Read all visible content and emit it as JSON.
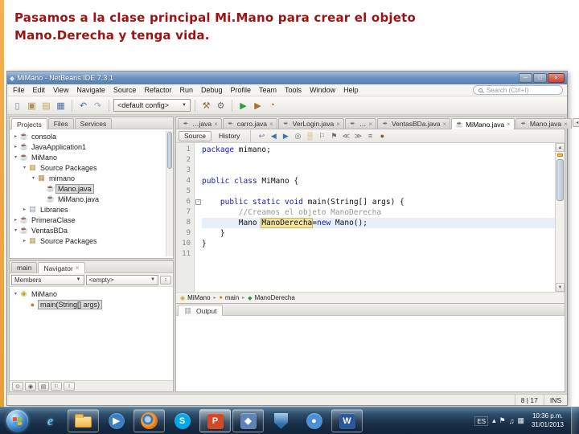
{
  "slide": {
    "title_lines": [
      "Pasamos a la clase principal Mi.Mano para crear el objeto",
      "Mano.Derecha y tenga vida."
    ],
    "accent_color": "#9c1313"
  },
  "window": {
    "title": "MiMano - NetBeans IDE 7.3.1",
    "controls": {
      "minimize": "─",
      "maximize": "□",
      "close": "×"
    },
    "menu": [
      "File",
      "Edit",
      "View",
      "Navigate",
      "Source",
      "Refactor",
      "Run",
      "Debug",
      "Profile",
      "Team",
      "Tools",
      "Window",
      "Help"
    ],
    "search_placeholder": "Search (Ctrl+I)"
  },
  "toolbar": {
    "config_value": "<default config>",
    "file_icons": [
      {
        "name": "new-file-icon",
        "glyph": "▯",
        "color": "#7d8b99"
      },
      {
        "name": "new-project-icon",
        "glyph": "▣",
        "color": "#b08d55"
      },
      {
        "name": "open-project-icon",
        "glyph": "▤",
        "color": "#c9a05a"
      },
      {
        "name": "save-all-icon",
        "glyph": "▦",
        "color": "#4a6fae"
      }
    ],
    "edit_icons": [
      {
        "name": "undo-icon",
        "glyph": "↶",
        "color": "#4a6fae"
      },
      {
        "name": "redo-icon",
        "glyph": "↷",
        "color": "#9aa7b5"
      }
    ],
    "build_icons": [
      {
        "name": "build-project-icon",
        "glyph": "⚒",
        "color": "#8a6d3b"
      },
      {
        "name": "clean-build-icon",
        "glyph": "⚙",
        "color": "#6d6b67"
      }
    ],
    "run_icons": [
      {
        "name": "run-project-icon",
        "glyph": "▶",
        "color": "#2e9e3f"
      },
      {
        "name": "debug-project-icon",
        "glyph": "▶",
        "color": "#a8722a"
      },
      {
        "name": "profile-project-icon",
        "glyph": "◔",
        "color": "#b5651d"
      }
    ]
  },
  "icon_map": {
    "project": {
      "glyph": "☕",
      "color": "#8a5a2e"
    },
    "package-root": {
      "glyph": "▦",
      "color": "#c59a52"
    },
    "package": {
      "glyph": "▦",
      "color": "#b5833f"
    },
    "java": {
      "glyph": "☕",
      "color": "#49708f"
    },
    "libraries": {
      "glyph": "▤",
      "color": "#8a97a5"
    },
    "class": {
      "glyph": "◉",
      "color": "#caa22a"
    },
    "method": {
      "glyph": "●",
      "color": "#d96f1e"
    },
    "variable": {
      "glyph": "◆",
      "color": "#2f8a4c"
    }
  },
  "projects": {
    "tabs": [
      {
        "label": "Projects",
        "active": true
      },
      {
        "label": "Files",
        "active": false
      },
      {
        "label": "Services",
        "active": false
      }
    ],
    "tree": [
      {
        "label": "consola",
        "icon": "project",
        "level": 0,
        "exp": "collapsed",
        "selected": false
      },
      {
        "label": "JavaApplication1",
        "icon": "project",
        "level": 0,
        "exp": "collapsed",
        "selected": false
      },
      {
        "label": "MiMano",
        "icon": "project",
        "level": 0,
        "exp": "expanded",
        "selected": false
      },
      {
        "label": "Source Packages",
        "icon": "package-root",
        "level": 1,
        "exp": "expanded",
        "selected": false
      },
      {
        "label": "mimano",
        "icon": "package",
        "level": 2,
        "exp": "expanded",
        "selected": false
      },
      {
        "label": "Mano.java",
        "icon": "java",
        "level": 3,
        "exp": "none",
        "selected": true
      },
      {
        "label": "MiMano.java",
        "icon": "java",
        "level": 3,
        "exp": "none",
        "selected": false
      },
      {
        "label": "Libraries",
        "icon": "libraries",
        "level": 1,
        "exp": "collapsed",
        "selected": false
      },
      {
        "label": "PrimeraClase",
        "icon": "project",
        "level": 0,
        "exp": "collapsed",
        "selected": false
      },
      {
        "label": "VentasBDa",
        "icon": "project",
        "level": 0,
        "exp": "expanded",
        "selected": false
      },
      {
        "label": "Source Packages",
        "icon": "package-root",
        "level": 1,
        "exp": "collapsed",
        "selected": false
      }
    ]
  },
  "navigator": {
    "tabs": [
      {
        "label": "main",
        "active": false
      },
      {
        "label": "Navigator",
        "active": true,
        "closable": true
      }
    ],
    "members_label": "Members",
    "filter_value": "<empty>",
    "tree": [
      {
        "label": "MiMano",
        "icon": "class",
        "level": 0,
        "exp": "expanded",
        "selected": false
      },
      {
        "label": "main(String[] args)",
        "icon": "method",
        "level": 1,
        "exp": "none",
        "selected": true
      }
    ],
    "footer_icons": [
      {
        "name": "show-inherited-icon",
        "glyph": "⊙"
      },
      {
        "name": "show-fields-icon",
        "glyph": "◉"
      },
      {
        "name": "show-static-icon",
        "glyph": "▤"
      },
      {
        "name": "show-non-public-icon",
        "glyph": "⚐"
      },
      {
        "name": "sort-alpha-icon",
        "glyph": "↕"
      }
    ]
  },
  "editor": {
    "tabs": [
      {
        "label": "…java",
        "active": false
      },
      {
        "label": "carro.java",
        "active": false
      },
      {
        "label": "VerLogin.java",
        "active": false
      },
      {
        "label": "…",
        "active": false
      },
      {
        "label": "VentasBDa.java",
        "active": false
      },
      {
        "label": "MiMano.java",
        "active": true
      },
      {
        "label": "Mano.java",
        "active": false
      }
    ],
    "source_label": "Source",
    "history_label": "History",
    "toolbar_icons": [
      {
        "name": "last-edit-icon",
        "glyph": "↩",
        "color": "#7a6fae"
      },
      {
        "name": "back-icon",
        "glyph": "◀",
        "color": "#4a6fae"
      },
      {
        "name": "forward-icon",
        "glyph": "▶",
        "color": "#4a6fae"
      },
      {
        "name": "find-selection-icon",
        "glyph": "◎",
        "color": "#6d6b67"
      },
      {
        "name": "highlight-icon",
        "glyph": "▒",
        "color": "#c9a05a"
      },
      {
        "name": "previous-bookmark-icon",
        "glyph": "⚐",
        "color": "#6d6b67"
      },
      {
        "name": "next-bookmark-icon",
        "glyph": "⚑",
        "color": "#6d6b67"
      },
      {
        "name": "previous-error-icon",
        "glyph": "≪",
        "color": "#6d6b67"
      },
      {
        "name": "next-error-icon",
        "glyph": "≫",
        "color": "#6d6b67"
      },
      {
        "name": "comment-icon",
        "glyph": "≡",
        "color": "#6d6b67"
      },
      {
        "name": "macro-icon",
        "glyph": "●",
        "color": "#8a5a2e"
      }
    ],
    "code_lines": [
      {
        "n": 1,
        "fold": false,
        "current": false,
        "tokens": [
          {
            "s": "kw",
            "v": "package"
          },
          {
            "s": "pl",
            "v": " mimano;"
          }
        ]
      },
      {
        "n": 2,
        "fold": false,
        "current": false,
        "tokens": []
      },
      {
        "n": 3,
        "fold": false,
        "current": false,
        "tokens": []
      },
      {
        "n": 4,
        "fold": false,
        "current": false,
        "tokens": [
          {
            "s": "kw",
            "v": "public"
          },
          {
            "s": "pl",
            "v": " "
          },
          {
            "s": "kw",
            "v": "class"
          },
          {
            "s": "pl",
            "v": " MiMano {"
          }
        ]
      },
      {
        "n": 5,
        "fold": false,
        "current": false,
        "tokens": []
      },
      {
        "n": 6,
        "fold": true,
        "current": false,
        "tokens": [
          {
            "s": "pl",
            "v": "    "
          },
          {
            "s": "kw",
            "v": "public"
          },
          {
            "s": "pl",
            "v": " "
          },
          {
            "s": "kw",
            "v": "static"
          },
          {
            "s": "pl",
            "v": " "
          },
          {
            "s": "kw",
            "v": "void"
          },
          {
            "s": "pl",
            "v": " main(String[] args) {"
          }
        ]
      },
      {
        "n": 7,
        "fold": false,
        "current": false,
        "tokens": [
          {
            "s": "pl",
            "v": "        "
          },
          {
            "s": "cm",
            "v": "//Creamos el objeto ManoDerecha"
          }
        ]
      },
      {
        "n": 8,
        "fold": false,
        "current": true,
        "tokens": [
          {
            "s": "pl",
            "v": "        Mano "
          },
          {
            "s": "mk",
            "v": "ManoDerecha"
          },
          {
            "s": "pl",
            "v": "="
          },
          {
            "s": "kw",
            "v": "new"
          },
          {
            "s": "pl",
            "v": " Mano();"
          }
        ]
      },
      {
        "n": 9,
        "fold": false,
        "current": false,
        "tokens": [
          {
            "s": "pl",
            "v": "    }"
          }
        ]
      },
      {
        "n": 10,
        "fold": false,
        "current": false,
        "tokens": [
          {
            "s": "pl",
            "v": "}"
          }
        ]
      },
      {
        "n": 11,
        "fold": false,
        "current": false,
        "tokens": []
      }
    ],
    "breadcrumb": [
      {
        "label": "MiMano",
        "icon": "class"
      },
      {
        "label": "main",
        "icon": "method"
      },
      {
        "label": "ManoDerecha",
        "icon": "variable"
      }
    ]
  },
  "output": {
    "tab": "Output"
  },
  "status": {
    "caret": "8 | 17",
    "mode": "INS"
  },
  "taskbar": {
    "language": "ES",
    "time": "10:36 p.m.",
    "date": "31/01/2013",
    "buttons": [
      {
        "id": "ie",
        "kind": "letter",
        "glyph": "e",
        "color": "#6fbdf5",
        "bg": "",
        "open": false,
        "active": false
      },
      {
        "id": "explorer",
        "kind": "folder",
        "glyph": "",
        "color": "",
        "bg": "",
        "open": true,
        "active": false
      },
      {
        "id": "media-player",
        "kind": "circle",
        "glyph": "▶",
        "color": "",
        "bg": "#3a7fc2",
        "open": false,
        "active": false
      },
      {
        "id": "firefox",
        "kind": "firefox",
        "glyph": "",
        "color": "",
        "bg": "",
        "open": true,
        "active": false
      },
      {
        "id": "skype",
        "kind": "circle",
        "glyph": "S",
        "color": "",
        "bg": "#00a8e8",
        "open": false,
        "active": false
      },
      {
        "id": "powerpoint",
        "kind": "square",
        "glyph": "P",
        "color": "",
        "bg": "#d04a28",
        "open": true,
        "active": true
      },
      {
        "id": "netbeans",
        "kind": "square",
        "glyph": "◆",
        "color": "",
        "bg": "#5d84b4",
        "open": true,
        "active": false
      },
      {
        "id": "shield",
        "kind": "shield",
        "glyph": "",
        "color": "",
        "bg": "",
        "open": false,
        "active": false
      },
      {
        "id": "messenger",
        "kind": "circle",
        "glyph": "●",
        "color": "",
        "bg": "#4a90d9",
        "open": false,
        "active": false
      },
      {
        "id": "word",
        "kind": "square",
        "glyph": "W",
        "color": "",
        "bg": "#2b579a",
        "open": true,
        "active": false
      }
    ],
    "tray_icons": [
      {
        "id": "hidden-icons-chevron",
        "glyph": "▴"
      },
      {
        "id": "action-center-flag",
        "glyph": "⚑"
      },
      {
        "id": "volume",
        "glyph": "♫"
      },
      {
        "id": "network",
        "glyph": "▦"
      }
    ]
  }
}
